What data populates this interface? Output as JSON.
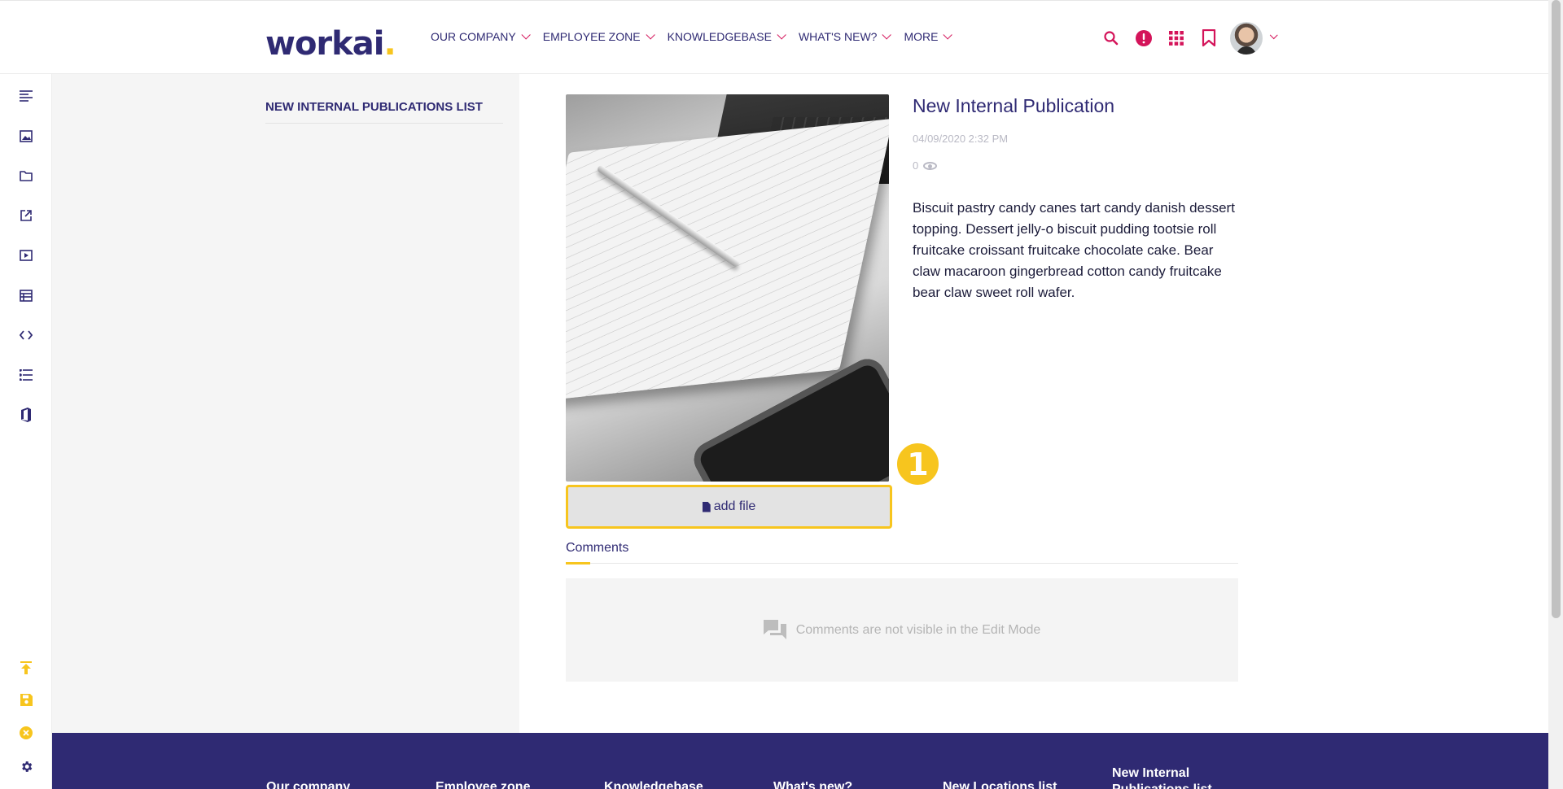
{
  "app": {
    "logo_text": "workai",
    "logo_dot": "."
  },
  "colors": {
    "brand": "#2f2a73",
    "accent": "#f7c51e",
    "alert": "#d4145a"
  },
  "nav": {
    "items": [
      {
        "label": "OUR COMPANY"
      },
      {
        "label": "EMPLOYEE ZONE"
      },
      {
        "label": "KNOWLEDGEBASE"
      },
      {
        "label": "WHAT'S NEW?"
      },
      {
        "label": "MORE"
      }
    ]
  },
  "header_icons": [
    "search-icon",
    "alert-icon",
    "apps-grid-icon",
    "bookmark-icon",
    "avatar"
  ],
  "toolbar_icons": [
    "text-align-icon",
    "image-icon",
    "folder-icon",
    "external-link-icon",
    "video-icon",
    "table-icon",
    "code-icon",
    "list-icon",
    "office-icon",
    "upload-icon",
    "save-icon",
    "close-icon",
    "gear-icon"
  ],
  "sidebar": {
    "title": "NEW INTERNAL PUBLICATIONS LIST"
  },
  "publication": {
    "title": "New Internal Publication",
    "date": "04/09/2020 2:32 PM",
    "views": "0",
    "body": "Biscuit pastry candy canes tart candy danish dessert topping. Dessert jelly-o biscuit pudding tootsie roll fruitcake croissant fruitcake chocolate cake. Bear claw macaroon gingerbread cotton candy fruitcake bear claw sweet roll wafer.",
    "step_badge": "1",
    "add_file_label": "add file"
  },
  "comments": {
    "tab_label": "Comments",
    "empty_message": "Comments are not visible in the Edit Mode"
  },
  "footer": {
    "columns": [
      {
        "label": "Our company"
      },
      {
        "label": "Employee zone"
      },
      {
        "label": "Knowledgebase"
      },
      {
        "label": "What's new?"
      },
      {
        "label": "New Locations list"
      },
      {
        "label": "New Internal Publications list"
      }
    ]
  }
}
